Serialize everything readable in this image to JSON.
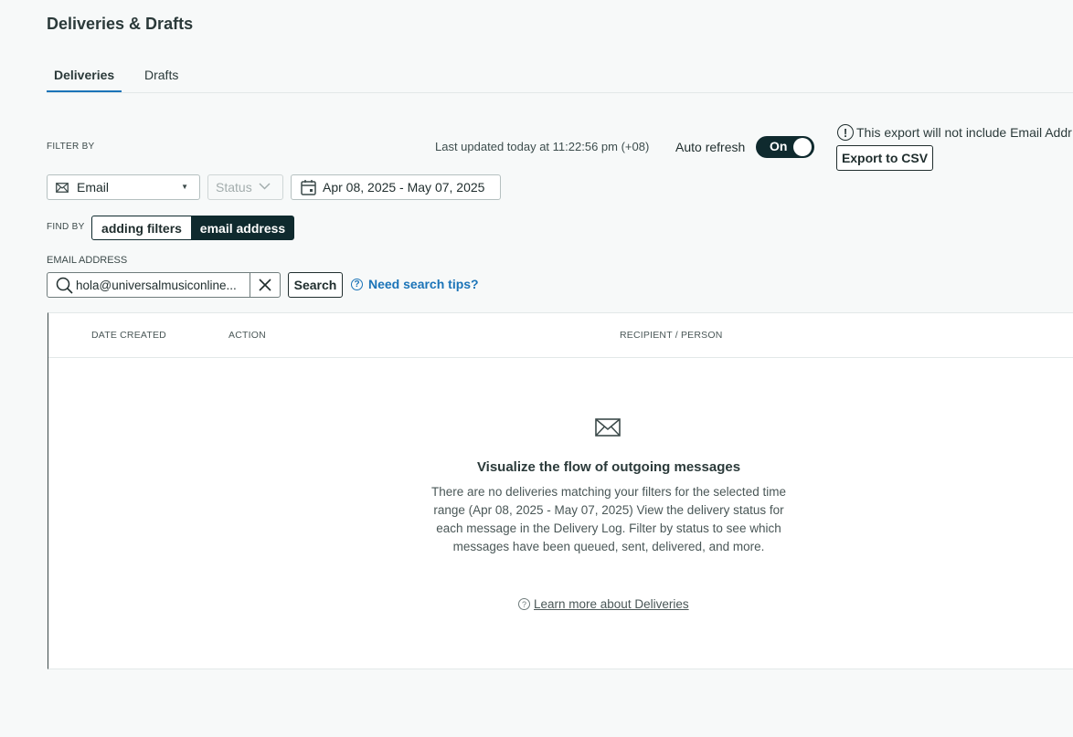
{
  "page": {
    "title": "Deliveries & Drafts"
  },
  "tabs": [
    {
      "label": "Deliveries",
      "active": true
    },
    {
      "label": "Drafts",
      "active": false
    }
  ],
  "filters": {
    "filter_by_label": "FILTER BY",
    "last_updated": "Last updated today at 11:22:56 pm (+08)",
    "auto_refresh_label": "Auto refresh",
    "auto_refresh_state": "On",
    "export_note": "This export will not include Email Addr",
    "export_button": "Export to CSV",
    "channel_select": {
      "value": "Email",
      "icon": "envelope-icon"
    },
    "status_select": {
      "placeholder": "Status"
    },
    "date_range": {
      "value": "Apr 08, 2025 - May 07, 2025",
      "icon": "calendar-icon"
    }
  },
  "find_by": {
    "label": "FIND BY",
    "options": [
      {
        "label": "adding filters",
        "selected": false
      },
      {
        "label": "email address",
        "selected": true
      }
    ]
  },
  "search": {
    "label": "EMAIL ADDRESS",
    "value": "hola@universalmusiconline...",
    "button": "Search",
    "tips_link": "Need search tips?"
  },
  "table": {
    "columns": [
      "DATE CREATED",
      "ACTION",
      "RECIPIENT / PERSON"
    ],
    "rows": []
  },
  "empty_state": {
    "icon": "envelope-icon",
    "title": "Visualize the flow of outgoing messages",
    "body": "There are no deliveries matching your filters for the selected time range (Apr 08, 2025 - May 07, 2025) View the delivery status for each message in the Delivery Log. Filter by status to see which messages have been queued, sent, delivered, and more.",
    "link": "Learn more about Deliveries"
  },
  "colors": {
    "accent_dark": "#0f2a2e",
    "link_blue": "#1b74b8",
    "background": "#f7f9f9"
  }
}
